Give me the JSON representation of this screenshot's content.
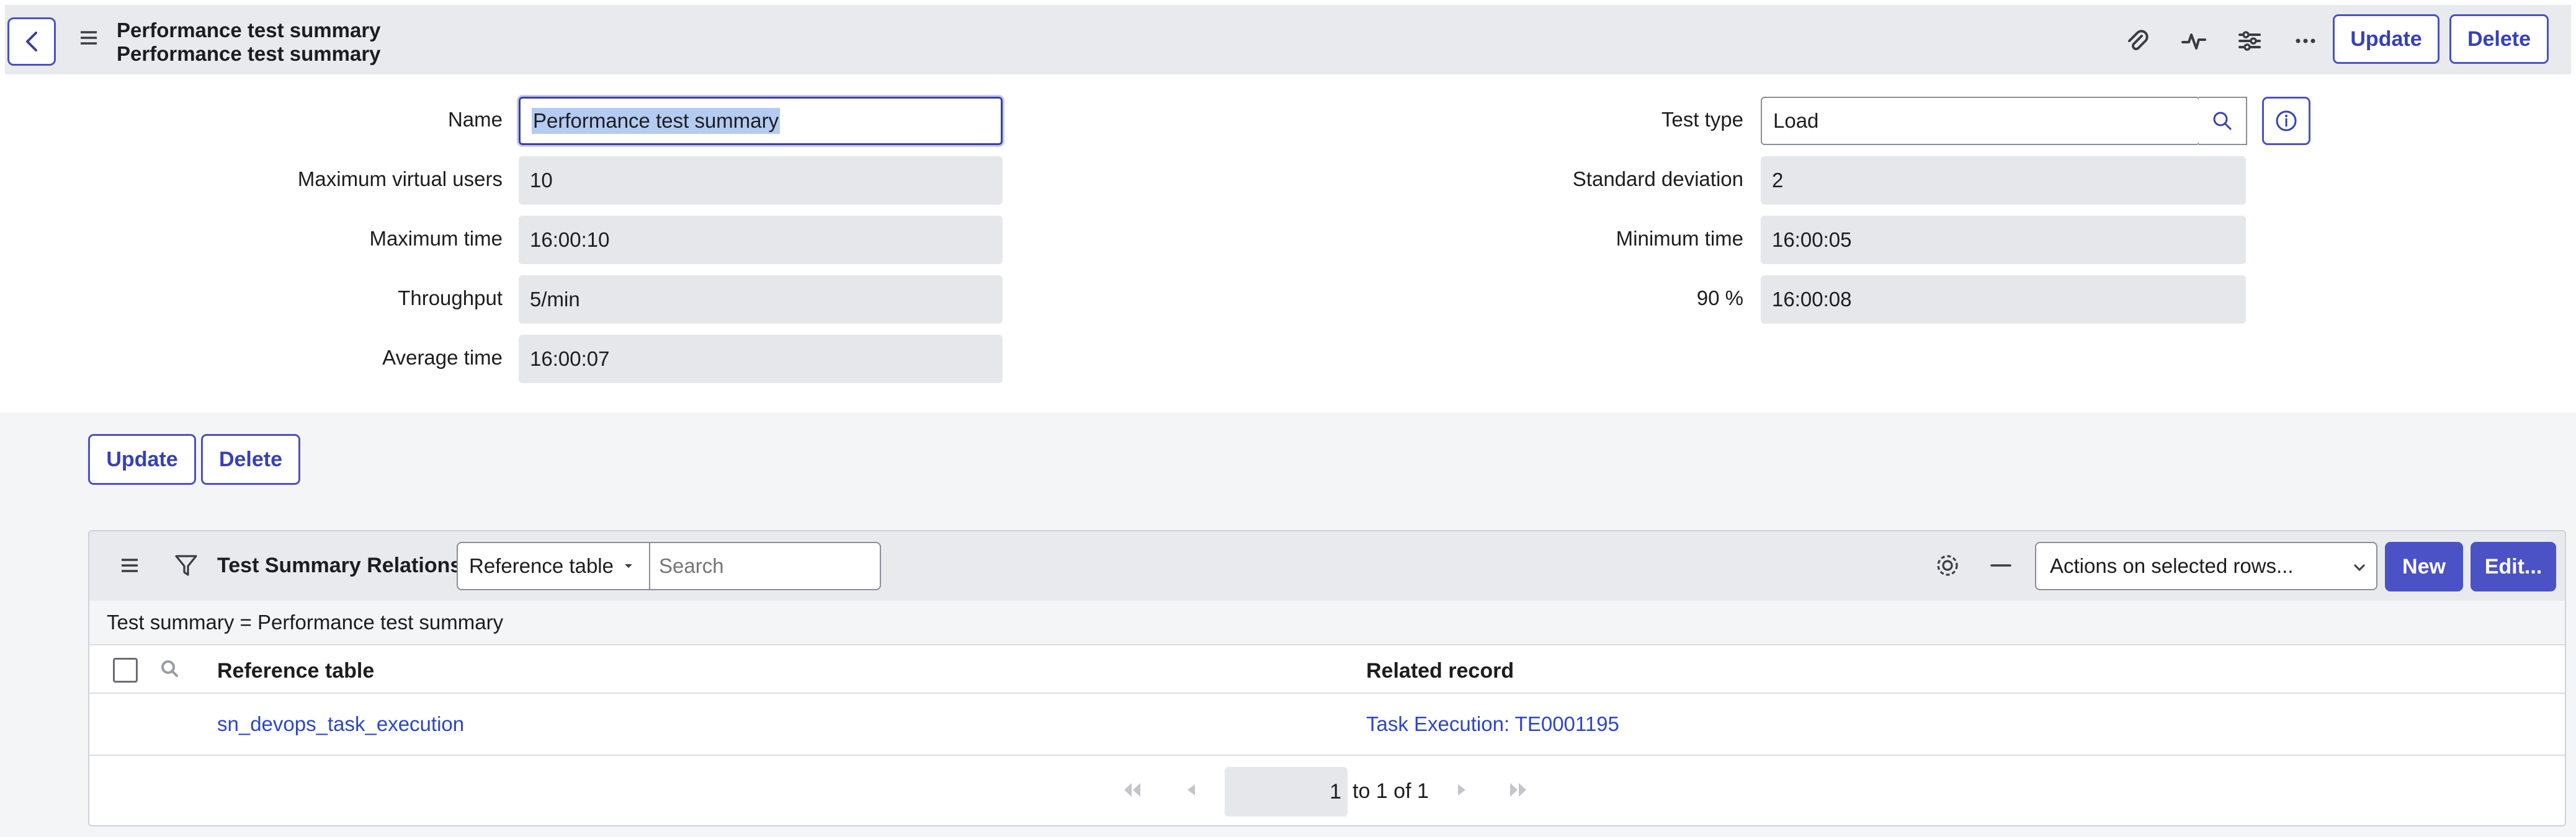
{
  "header": {
    "title_line1": "Performance test summary",
    "title_line2": "Performance test summary",
    "update_label": "Update",
    "delete_label": "Delete"
  },
  "form": {
    "left": [
      {
        "label": "Name",
        "value": "Performance test summary"
      },
      {
        "label": "Maximum virtual users",
        "value": "10"
      },
      {
        "label": "Maximum time",
        "value": "16:00:10"
      },
      {
        "label": "Throughput",
        "value": "5/min"
      },
      {
        "label": "Average time",
        "value": "16:00:07"
      }
    ],
    "right": [
      {
        "label": "Test type",
        "value": "Load"
      },
      {
        "label": "Standard deviation",
        "value": "2"
      },
      {
        "label": "Minimum time",
        "value": "16:00:05"
      },
      {
        "label": "90 %",
        "value": "16:00:08"
      }
    ]
  },
  "form_buttons": {
    "update_label": "Update",
    "delete_label": "Delete"
  },
  "related_list": {
    "title": "Test Summary Relations",
    "search_field_select": "Reference table",
    "search_placeholder": "Search",
    "actions_select": "Actions on selected rows...",
    "new_label": "New",
    "edit_label": "Edit...",
    "breadcrumb": "Test summary = Performance test summary",
    "columns": [
      "Reference table",
      "Related record"
    ],
    "rows": [
      {
        "reference_table": "sn_devops_task_execution",
        "related_record": "Task Execution: TE0001195"
      }
    ],
    "pager": {
      "page": "1",
      "range_text": "to 1 of 1"
    }
  },
  "colors": {
    "accent": "#4b52c6",
    "link": "#2c46c8",
    "header_bg": "#e9eaee"
  }
}
